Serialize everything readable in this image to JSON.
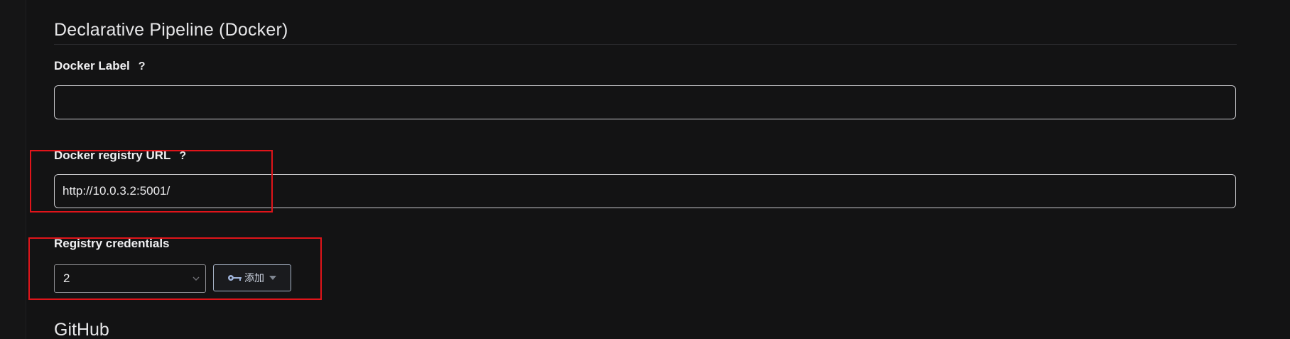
{
  "section": {
    "title": "Declarative Pipeline (Docker)"
  },
  "docker_label": {
    "label": "Docker Label",
    "help": "?",
    "value": ""
  },
  "registry_url": {
    "label": "Docker registry URL",
    "help": "?",
    "value": "http://10.0.3.2:5001/"
  },
  "registry_credentials": {
    "label": "Registry credentials",
    "selected": "2",
    "add_button_label": "添加"
  },
  "next_section": {
    "title": "GitHub"
  },
  "colors": {
    "background": "#131314",
    "annotation": "#e0141a",
    "key_icon": "#9fb3d9"
  }
}
